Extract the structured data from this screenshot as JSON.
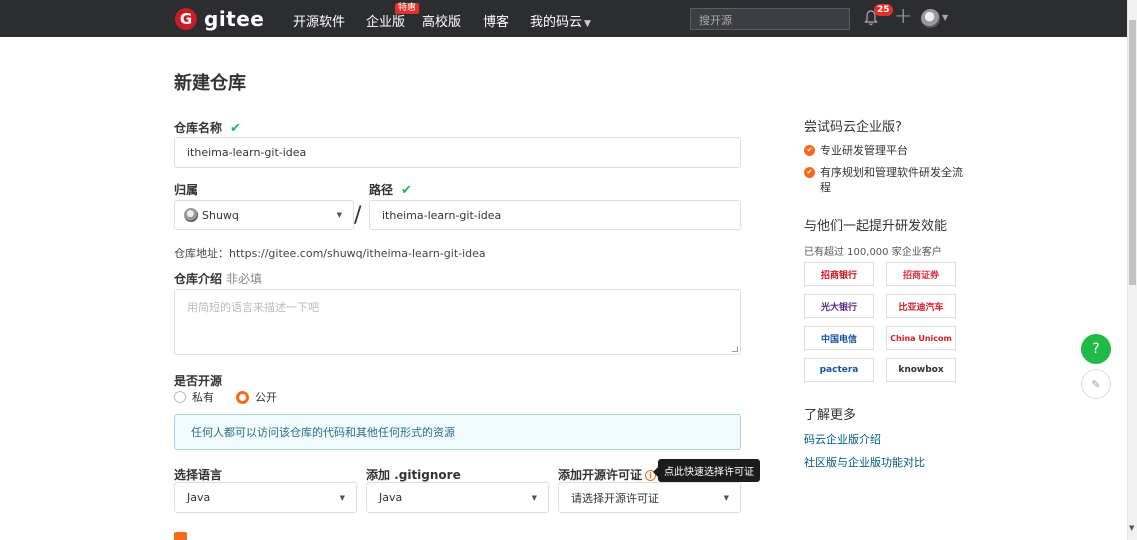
{
  "nav": {
    "logo_letter": "G",
    "logo_text": "gitee",
    "items": [
      "开源软件",
      "企业版",
      "高校版",
      "博客",
      "我的码云"
    ],
    "hot_badge": "特惠",
    "search_placeholder": "搜开源",
    "notification_count": "25",
    "plus": "+"
  },
  "page": {
    "title": "新建仓库"
  },
  "form": {
    "repo_name_label": "仓库名称",
    "repo_name_value": "itheima-learn-git-idea",
    "owner_label": "归属",
    "owner_value": "Shuwq",
    "path_label": "路径",
    "path_value": "itheima-learn-git-idea",
    "slash": "/",
    "repo_address": "仓库地址：https://gitee.com/shuwq/itheima-learn-git-idea",
    "intro_label": "仓库介绍",
    "intro_optional": "非必填",
    "intro_placeholder": "用简短的语言来描述一下吧",
    "visibility_label": "是否开源",
    "private_label": "私有",
    "public_label": "公开",
    "public_selected": true,
    "public_info": "任何人都可以访问该仓库的代码和其他任何形式的资源",
    "language_label": "选择语言",
    "language_value": "Java",
    "gitignore_label": "添加 .gitignore",
    "gitignore_value": "Java",
    "license_label": "添加开源许可证",
    "license_placeholder": "请选择开源许可证",
    "license_tooltip": "点此快速选择许可证"
  },
  "sidebar": {
    "enterprise_title": "尝试码云企业版?",
    "features": [
      "专业研发管理平台",
      "有序规划和管理软件研发全流程"
    ],
    "boost_title": "与他们一起提升研发效能",
    "boost_sub": "已有超过 100,000 家企业客户",
    "logos": [
      {
        "name": "招商银行",
        "color": "#c8161d"
      },
      {
        "name": "招商证券",
        "color": "#d9333f"
      },
      {
        "name": "光大银行",
        "color": "#5a2d82"
      },
      {
        "name": "比亚迪汽车",
        "color": "#d21f26"
      },
      {
        "name": "中国电信",
        "color": "#1a54a3"
      },
      {
        "name": "China Unicom",
        "color": "#d41f26"
      },
      {
        "name": "pactera",
        "color": "#1a54a3"
      },
      {
        "name": "knowbox",
        "color": "#333333"
      }
    ],
    "more_title": "了解更多",
    "links": [
      "码云企业版介绍",
      "社区版与企业版功能对比"
    ]
  },
  "float": {
    "help": "?",
    "edit": "✎"
  },
  "colors": {
    "accent": "#f56a1e",
    "success": "#21ba45",
    "nav_bg": "#2b2d31",
    "brand": "#c71d23"
  }
}
